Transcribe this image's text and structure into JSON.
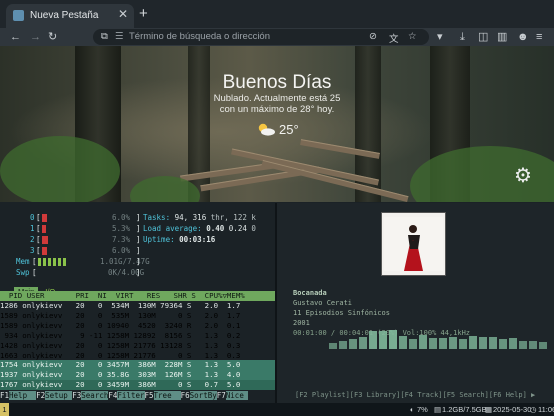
{
  "browser": {
    "tab_title": "Nueva Pestaña",
    "tab_close": "✕",
    "new_tab": "+",
    "omnibox_placeholder": "Término de búsqueda o dirección"
  },
  "ntp": {
    "greeting": "Buenos Días",
    "weather_line1": "Nublado. Actualmente está 25",
    "weather_line2": "con un máximo de 28° hoy.",
    "temperature": "25°",
    "weather_icon": "partly-cloudy-icon",
    "settings_icon": "gear-icon"
  },
  "htop": {
    "cpu": [
      {
        "label": "0",
        "value": "6.0%",
        "fill": 0.06
      },
      {
        "label": "1",
        "value": "5.3%",
        "fill": 0.053
      },
      {
        "label": "2",
        "value": "7.3%",
        "fill": 0.073
      },
      {
        "label": "3",
        "value": "6.0%",
        "fill": 0.06
      }
    ],
    "mem": {
      "label": "Mem",
      "value": "1.01G/7.47G"
    },
    "swp": {
      "label": "Swp",
      "value": "0K/4.00G"
    },
    "tasks": {
      "label": "Tasks:",
      "count": "94,",
      "thr": "316",
      "rest": " thr, 122 k"
    },
    "load": {
      "label": "Load average:",
      "v1": "0.40",
      "v2": "0.24",
      "v3": " 0"
    },
    "uptime": {
      "label": "Uptime:",
      "value": "00:03:16"
    },
    "tabs": [
      "Main",
      "I/O"
    ],
    "header": "  PID USER       PRI  NI  VIRT   RES   SHR S  CPU%▽MEM%",
    "processes": [
      "1286 onlykievv   20   0  534M  130M 79364 S   2.0  1.7",
      "1589 onlykievv   20   0  535M  130M     0 S   2.0  1.7",
      "1589 onlykievv   20   0 10940  4520  3240 R   2.0  0.1",
      " 934 onlykievv    9 -11 1258M 12892  8156 S   1.3  0.2",
      "1428 onlykievv   20   0 1258M 21776 13128 S   1.3  0.3",
      "1663 onlykievv   20   0 1258M 21776     0 S   1.3  0.3",
      "1754 onlykievv   20   0 3457M  386M  228M S   1.3  5.0",
      "1937 onlykievv   20   0 35.8G  303M  126M S   1.3  4.0",
      "1767 onlykievv   20   0 3459M  386M     0 S   0.7  5.0"
    ],
    "fkeys": [
      {
        "key": "F1",
        "label": "Help  "
      },
      {
        "key": "F2",
        "label": "Setup "
      },
      {
        "key": "F3",
        "label": "Search"
      },
      {
        "key": "F4",
        "label": "Filter"
      },
      {
        "key": "F5",
        "label": "Tree  "
      },
      {
        "key": "F6",
        "label": "SortBy"
      },
      {
        "key": "F7",
        "label": "Nice "
      }
    ]
  },
  "player": {
    "title": "Bocanada",
    "artist": "Gustavo Cerati",
    "album": "11 Episodios Sinfónicos",
    "year": "2001",
    "progress": "00:01:00 / 00:04:01 (20%) Vol:100% 44,1kHz",
    "progress_fraction": 0.2,
    "keys": "[F2 Playlist][F3 Library][F4 Track][F5 Search][F6 Help] ▶",
    "visualizer_levels": [
      0.25,
      0.35,
      0.45,
      0.55,
      0.8,
      0.8,
      0.85,
      0.6,
      0.45,
      0.65,
      0.5,
      0.5,
      0.55,
      0.45,
      0.6,
      0.55,
      0.55,
      0.45,
      0.5,
      0.35,
      0.35,
      0.3
    ]
  },
  "status": {
    "workspace": "1",
    "battery": "7%",
    "memory": "1.2GB/7.5GB",
    "date": "2025-05-30",
    "time": "11:06"
  }
}
